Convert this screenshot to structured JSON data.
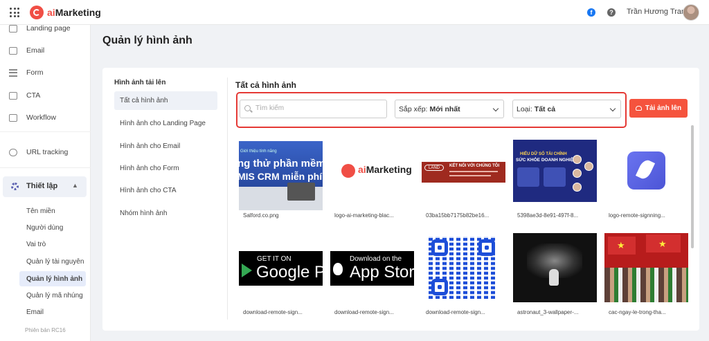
{
  "header": {
    "brand_prefix": "ai",
    "brand_suffix": "Marketing",
    "user_name": "Trần Hương Trang"
  },
  "sidebar": {
    "items": [
      {
        "label": "Landing page",
        "icon": "landing-page-icon"
      },
      {
        "label": "Email",
        "icon": "email-icon"
      },
      {
        "label": "Form",
        "icon": "form-icon"
      },
      {
        "label": "CTA",
        "icon": "cta-icon"
      },
      {
        "label": "Workflow",
        "icon": "workflow-icon"
      },
      {
        "label": "URL tracking",
        "icon": "link-icon"
      }
    ],
    "settings": {
      "label": "Thiết lập",
      "icon": "gear-icon",
      "expanded": true
    },
    "sub_items": [
      "Tên miền",
      "Người dùng",
      "Vai trò",
      "Quản lý tài nguyên",
      "Quản lý hình ảnh",
      "Quản lý mã nhúng",
      "Email"
    ],
    "active_sub_item": "Quản lý hình ảnh",
    "version": "Phiên bản RC16"
  },
  "page": {
    "title": "Quản lý hình ảnh"
  },
  "image_nav": {
    "title": "Hình ảnh tải lên",
    "items": [
      "Tất cả hình ảnh",
      "Hình ảnh cho Landing Page",
      "Hình ảnh cho Email",
      "Hình ảnh cho Form",
      "Hình ảnh cho CTA",
      "Nhóm hình ảnh"
    ],
    "active": "Tất cả hình ảnh"
  },
  "content": {
    "title": "Tất cả hình ảnh",
    "search_placeholder": "Tìm kiếm",
    "sort_label": "Sắp xếp:",
    "sort_value": "Mới nhất",
    "type_label": "Loại:",
    "type_value": "Tất cả",
    "upload_label": "Tải ảnh lên"
  },
  "thumbnails": {
    "t1": {
      "caption": "Salford.co.png",
      "tiny": "Giới thiệu tính năng",
      "line1": "ng thử phần mềm",
      "line2": "MIS CRM miễn phí"
    },
    "t2": {
      "caption": "logo-ai-marketing-blac...",
      "brand_prefix": "ai",
      "brand_suffix": "Marketing"
    },
    "t3": {
      "caption": "03ba15bb7175b82be16...",
      "land": "LAND",
      "headline": "KẾT NỐI VỚI CHÚNG TÔI"
    },
    "t4": {
      "caption": "5398ae3d-8e91-497f-8...",
      "hdr": "HIỂU DỮ SỐ TÀI CHÍNH",
      "hdr2": "SỨC KHỎE DOANH NGHIỆP"
    },
    "t5": {
      "caption": "logo-remote-signning..."
    },
    "t6": {
      "caption": "download-remote-sign...",
      "small": "GET IT ON",
      "big": "Google Play"
    },
    "t7": {
      "caption": "download-remote-sign...",
      "small": "Download on the",
      "big": "App Store"
    },
    "t8": {
      "caption": "download-remote-sign..."
    },
    "t9": {
      "caption": "astronaut_3-wallpaper-..."
    },
    "t10": {
      "caption": "cac-ngay-le-trong-tha..."
    }
  },
  "colors": {
    "accent": "#f5533d",
    "highlight_border": "#e53935",
    "active_bg": "#eef1f7"
  }
}
